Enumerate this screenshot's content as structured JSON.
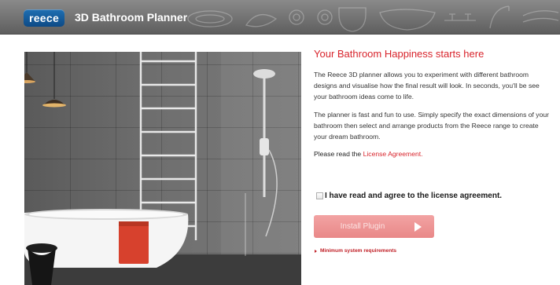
{
  "header": {
    "logo_text": "reece",
    "title": "3D Bathroom Planner",
    "background_color": "#6e6e6e",
    "logo_color": "#0d4a86"
  },
  "photo": {
    "subject": "bathroom-scene",
    "elements": [
      "pendant-lamp-icon",
      "towel-ladder-icon",
      "shower-rail-icon",
      "bathtub-icon",
      "red-towel",
      "black-stool"
    ]
  },
  "content": {
    "heading": "Your Bathroom Happiness starts here",
    "paragraph1": "The Reece 3D planner allows you to experiment with different bathroom designs and visualise how the final result will look. In seconds, you'll be see your bathroom ideas come to life.",
    "paragraph2": "The planner is fast and fun to use. Simply specify the exact dimensions of your bathroom then select and arrange products from the Reece range to create your dream bathroom.",
    "read_prefix": "Please read the ",
    "license_link": "License Agreement.",
    "agree_label": "I have read and agree to the license agreement.",
    "agree_checked": false,
    "install_label": "Install Plugin",
    "install_enabled": false,
    "sysreq_link": "Minimum system requirements",
    "accent_color": "#d8242c",
    "button_color": "#ee9898"
  }
}
